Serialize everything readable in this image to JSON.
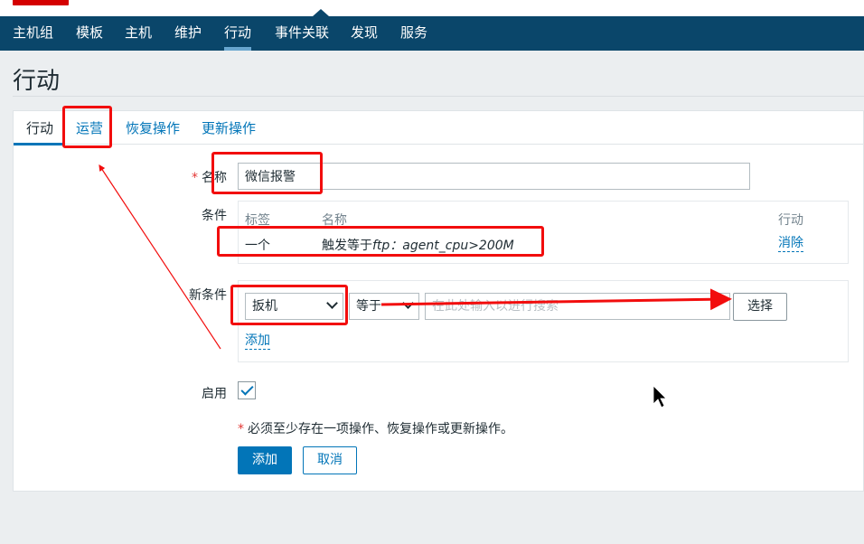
{
  "nav": {
    "items": [
      "主机组",
      "模板",
      "主机",
      "维护",
      "行动",
      "事件关联",
      "发现",
      "服务"
    ],
    "active_index": 4
  },
  "page": {
    "title": "行动"
  },
  "tabs": [
    "行动",
    "运营",
    "恢复操作",
    "更新操作"
  ],
  "form": {
    "name_label": "名称",
    "name_value": "微信报警",
    "conditions_label": "条件",
    "conditions_table": {
      "headers": [
        "标签",
        "名称",
        "行动"
      ],
      "rows": [
        {
          "label": "一个",
          "name_prefix": "触发等于",
          "name_italic": "ftp：agent_cpu>200M",
          "action": "消除"
        }
      ]
    },
    "new_condition_label": "新条件",
    "condition_type_selected": "扳机",
    "operator_selected": "等于",
    "search_placeholder": "在此处输入以进行搜索",
    "select_button": "选择",
    "add_link": "添加",
    "enabled_label": "启用",
    "enabled": true,
    "required_note": "必须至少存在一项操作、恢复操作或更新操作。",
    "required_mark": "*",
    "add_button": "添加",
    "cancel_button": "取消"
  },
  "colors": {
    "nav_bg": "#0a466a",
    "accent": "#0275b8",
    "annotation": "#f20d0d",
    "required": "#e33734"
  }
}
